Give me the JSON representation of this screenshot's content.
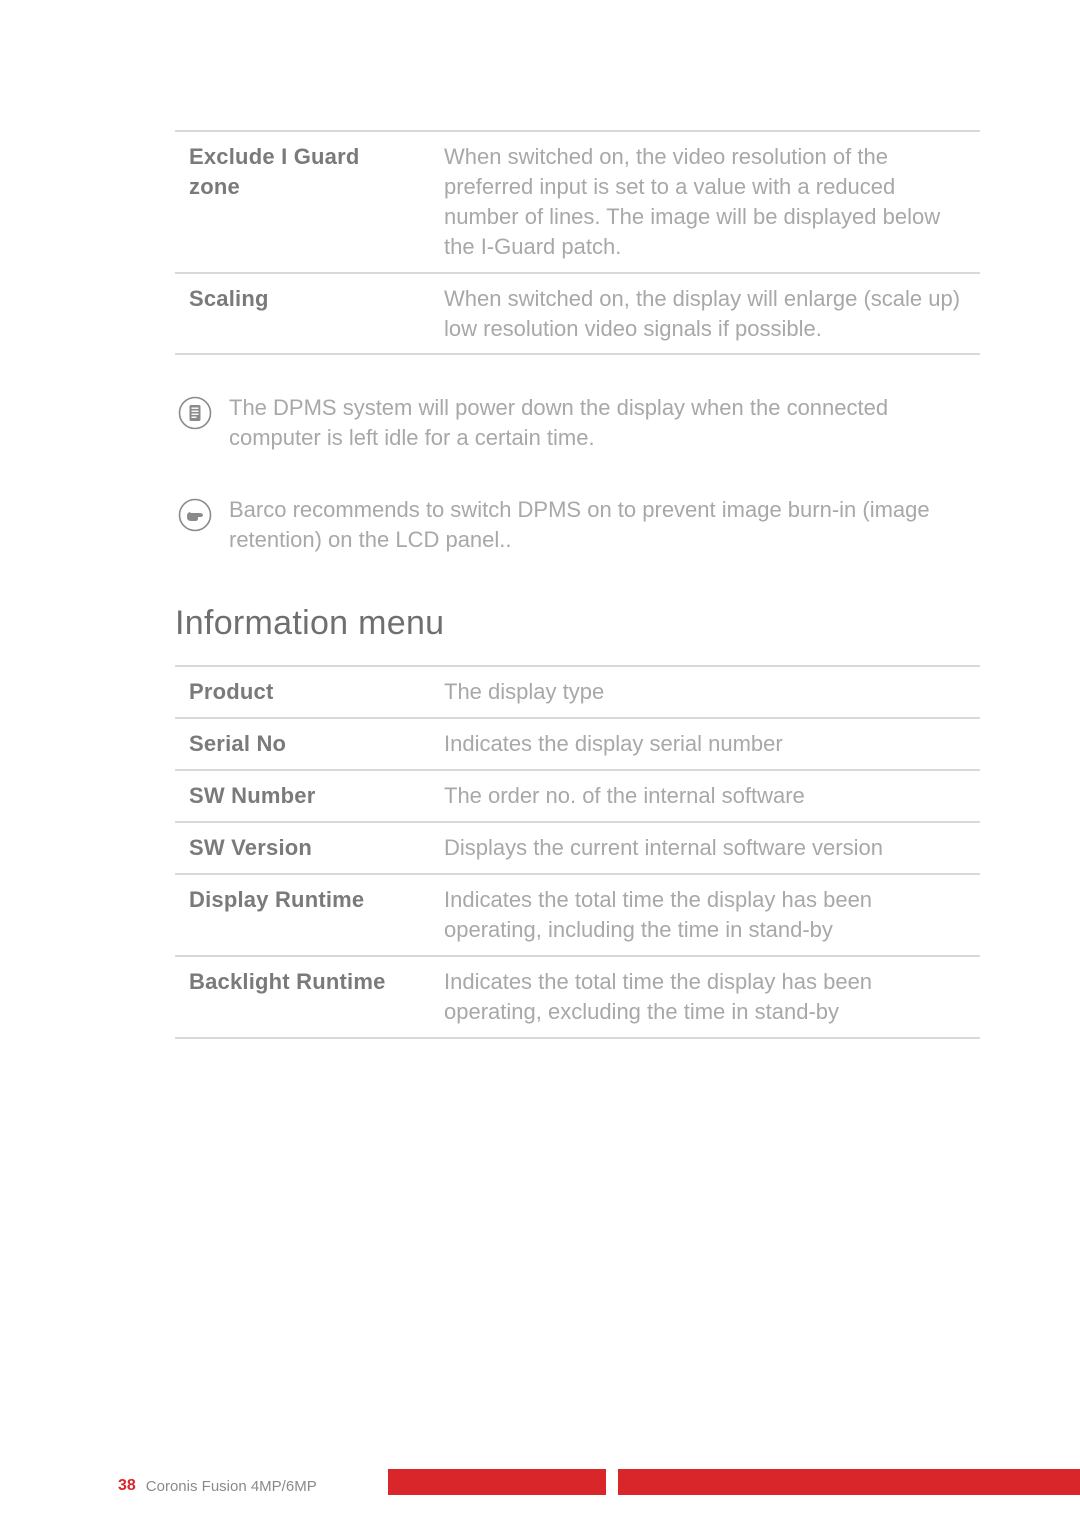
{
  "tables": {
    "first": [
      {
        "label": "Exclude I Guard zone",
        "desc": "When switched on, the video resolution of the preferred input is set to a value with a reduced number of lines. The image will be displayed below the I-Guard patch."
      },
      {
        "label": "Scaling",
        "desc": "When switched on, the display will enlarge (scale up) low resolution video signals if possible."
      }
    ],
    "info": [
      {
        "label": "Product",
        "desc": "The display type"
      },
      {
        "label": "Serial No",
        "desc": "Indicates the display serial number"
      },
      {
        "label": "SW Number",
        "desc": "The order no. of the internal software"
      },
      {
        "label": "SW Version",
        "desc": "Displays the current internal software version"
      },
      {
        "label": "Display Runtime",
        "desc": "Indicates the total time the display has been operating, including the time in stand-by"
      },
      {
        "label": "Backlight Runtime",
        "desc": "Indicates the total time the display has been operating, excluding the time in stand-by"
      }
    ]
  },
  "notes": {
    "dpms": "The DPMS system will power down the display when the connected computer is left idle for a certain time.",
    "burnin": "Barco recommends to switch DPMS on to prevent image burn-in (image retention) on the LCD panel.."
  },
  "heading": "Information menu",
  "footer": {
    "page": "38",
    "title": "Coronis Fusion 4MP/6MP"
  }
}
